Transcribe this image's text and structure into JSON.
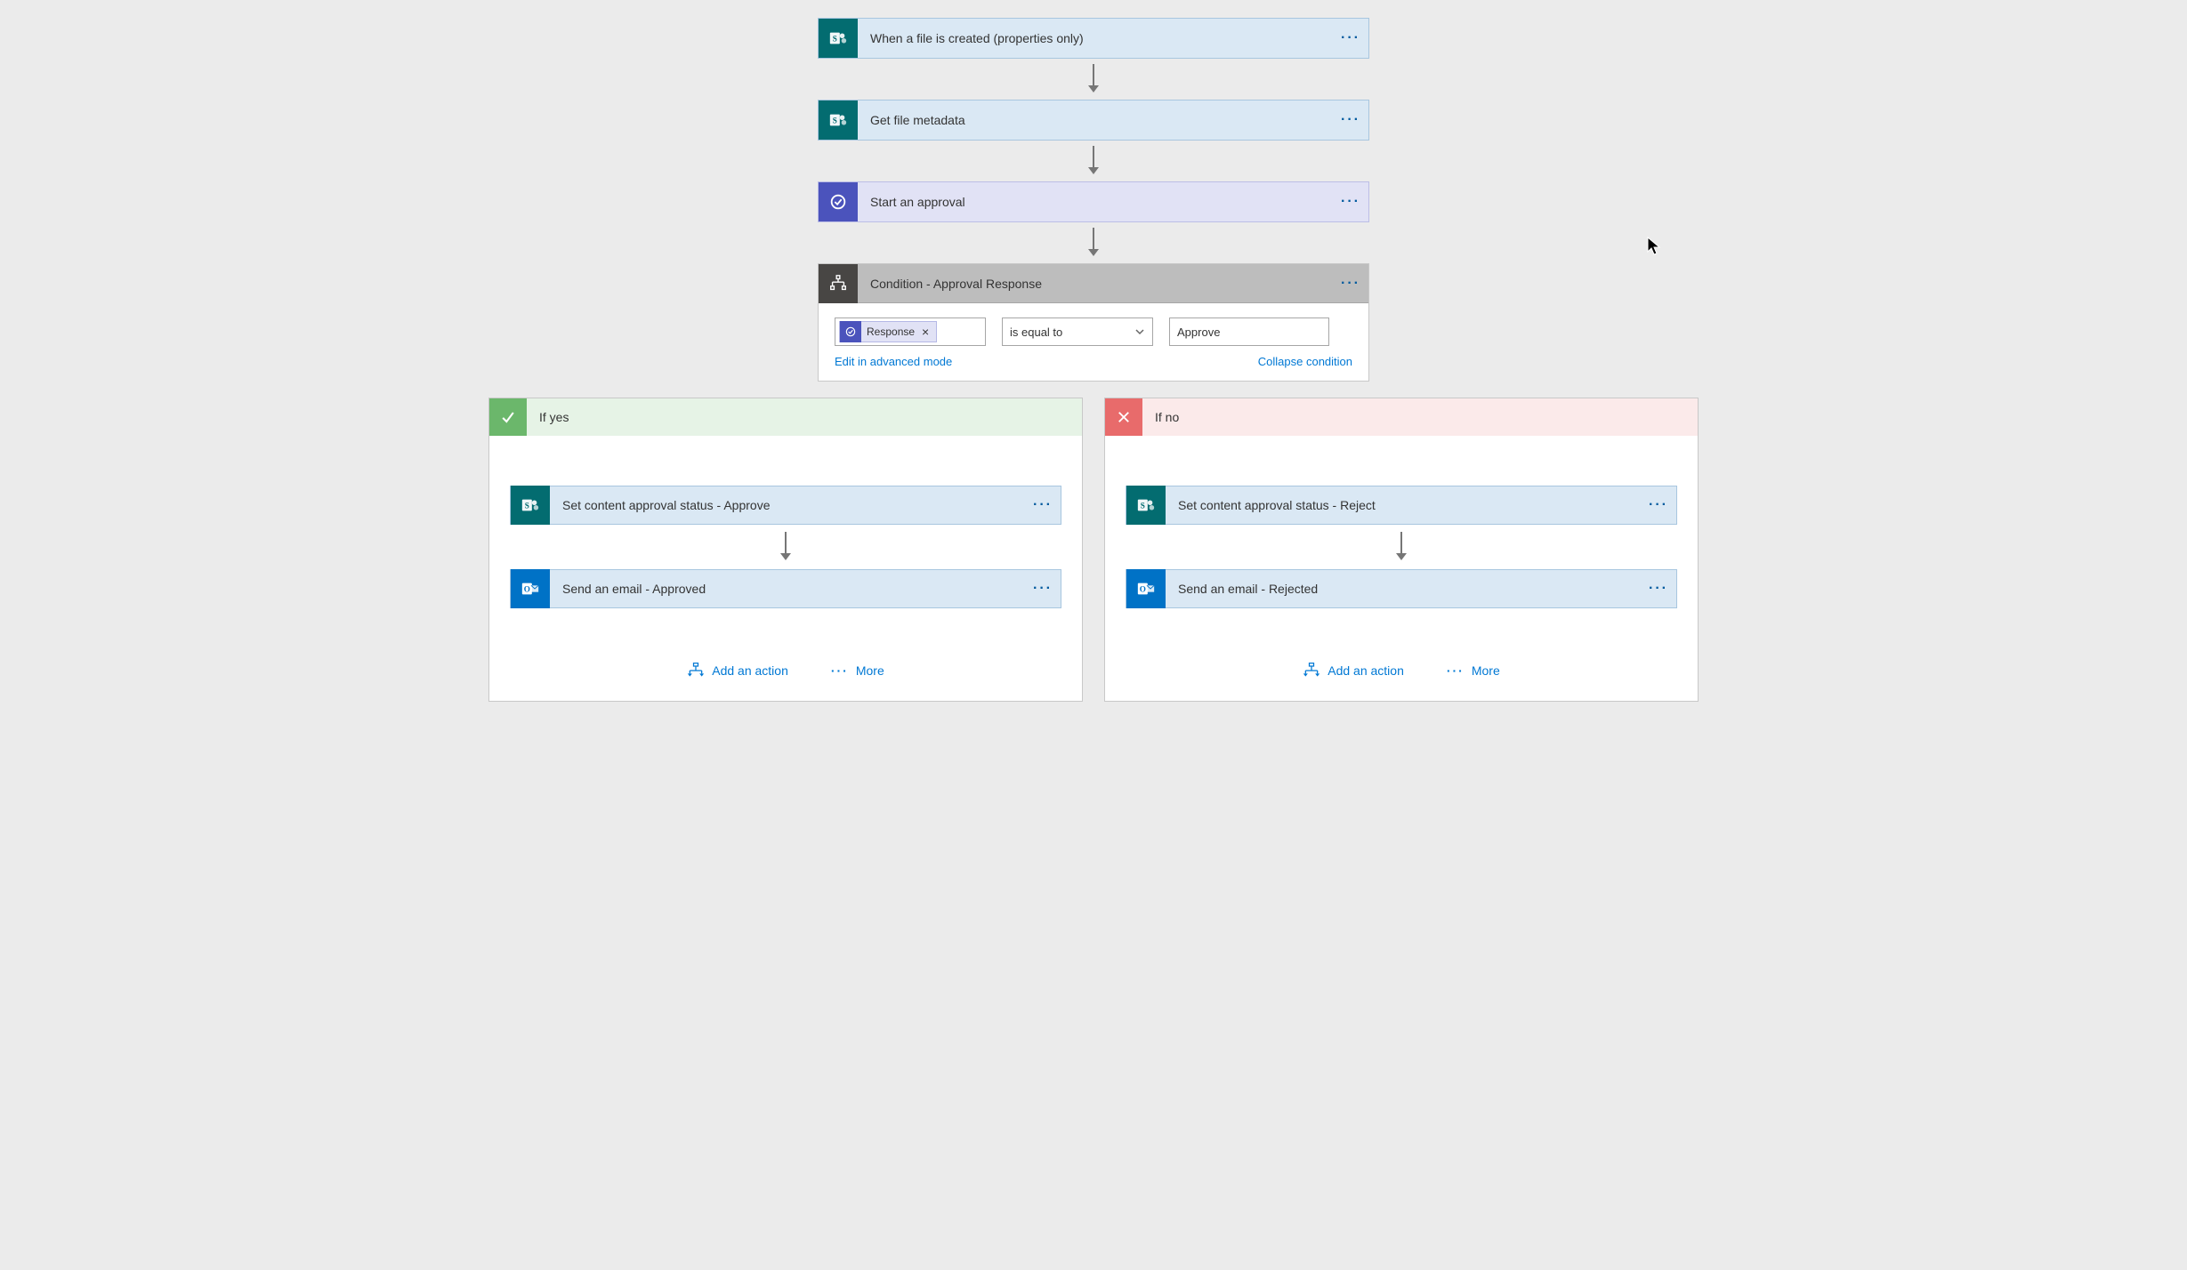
{
  "steps": {
    "s1": {
      "title": "When a file is created (properties only)"
    },
    "s2": {
      "title": "Get file metadata"
    },
    "s3": {
      "title": "Start an approval"
    },
    "s4": {
      "title": "Condition - Approval Response"
    }
  },
  "condition": {
    "chip_label": "Response",
    "operator": "is equal to",
    "value": "Approve",
    "edit_link": "Edit in advanced mode",
    "collapse_link": "Collapse condition"
  },
  "branches": {
    "yes": {
      "title": "If yes",
      "actions": {
        "a1": "Set content approval status - Approve",
        "a2": "Send an email - Approved"
      }
    },
    "no": {
      "title": "If no",
      "actions": {
        "a1": "Set content approval status - Reject",
        "a2": "Send an email - Rejected"
      }
    }
  },
  "footer": {
    "add_action": "Add an action",
    "more": "More"
  }
}
